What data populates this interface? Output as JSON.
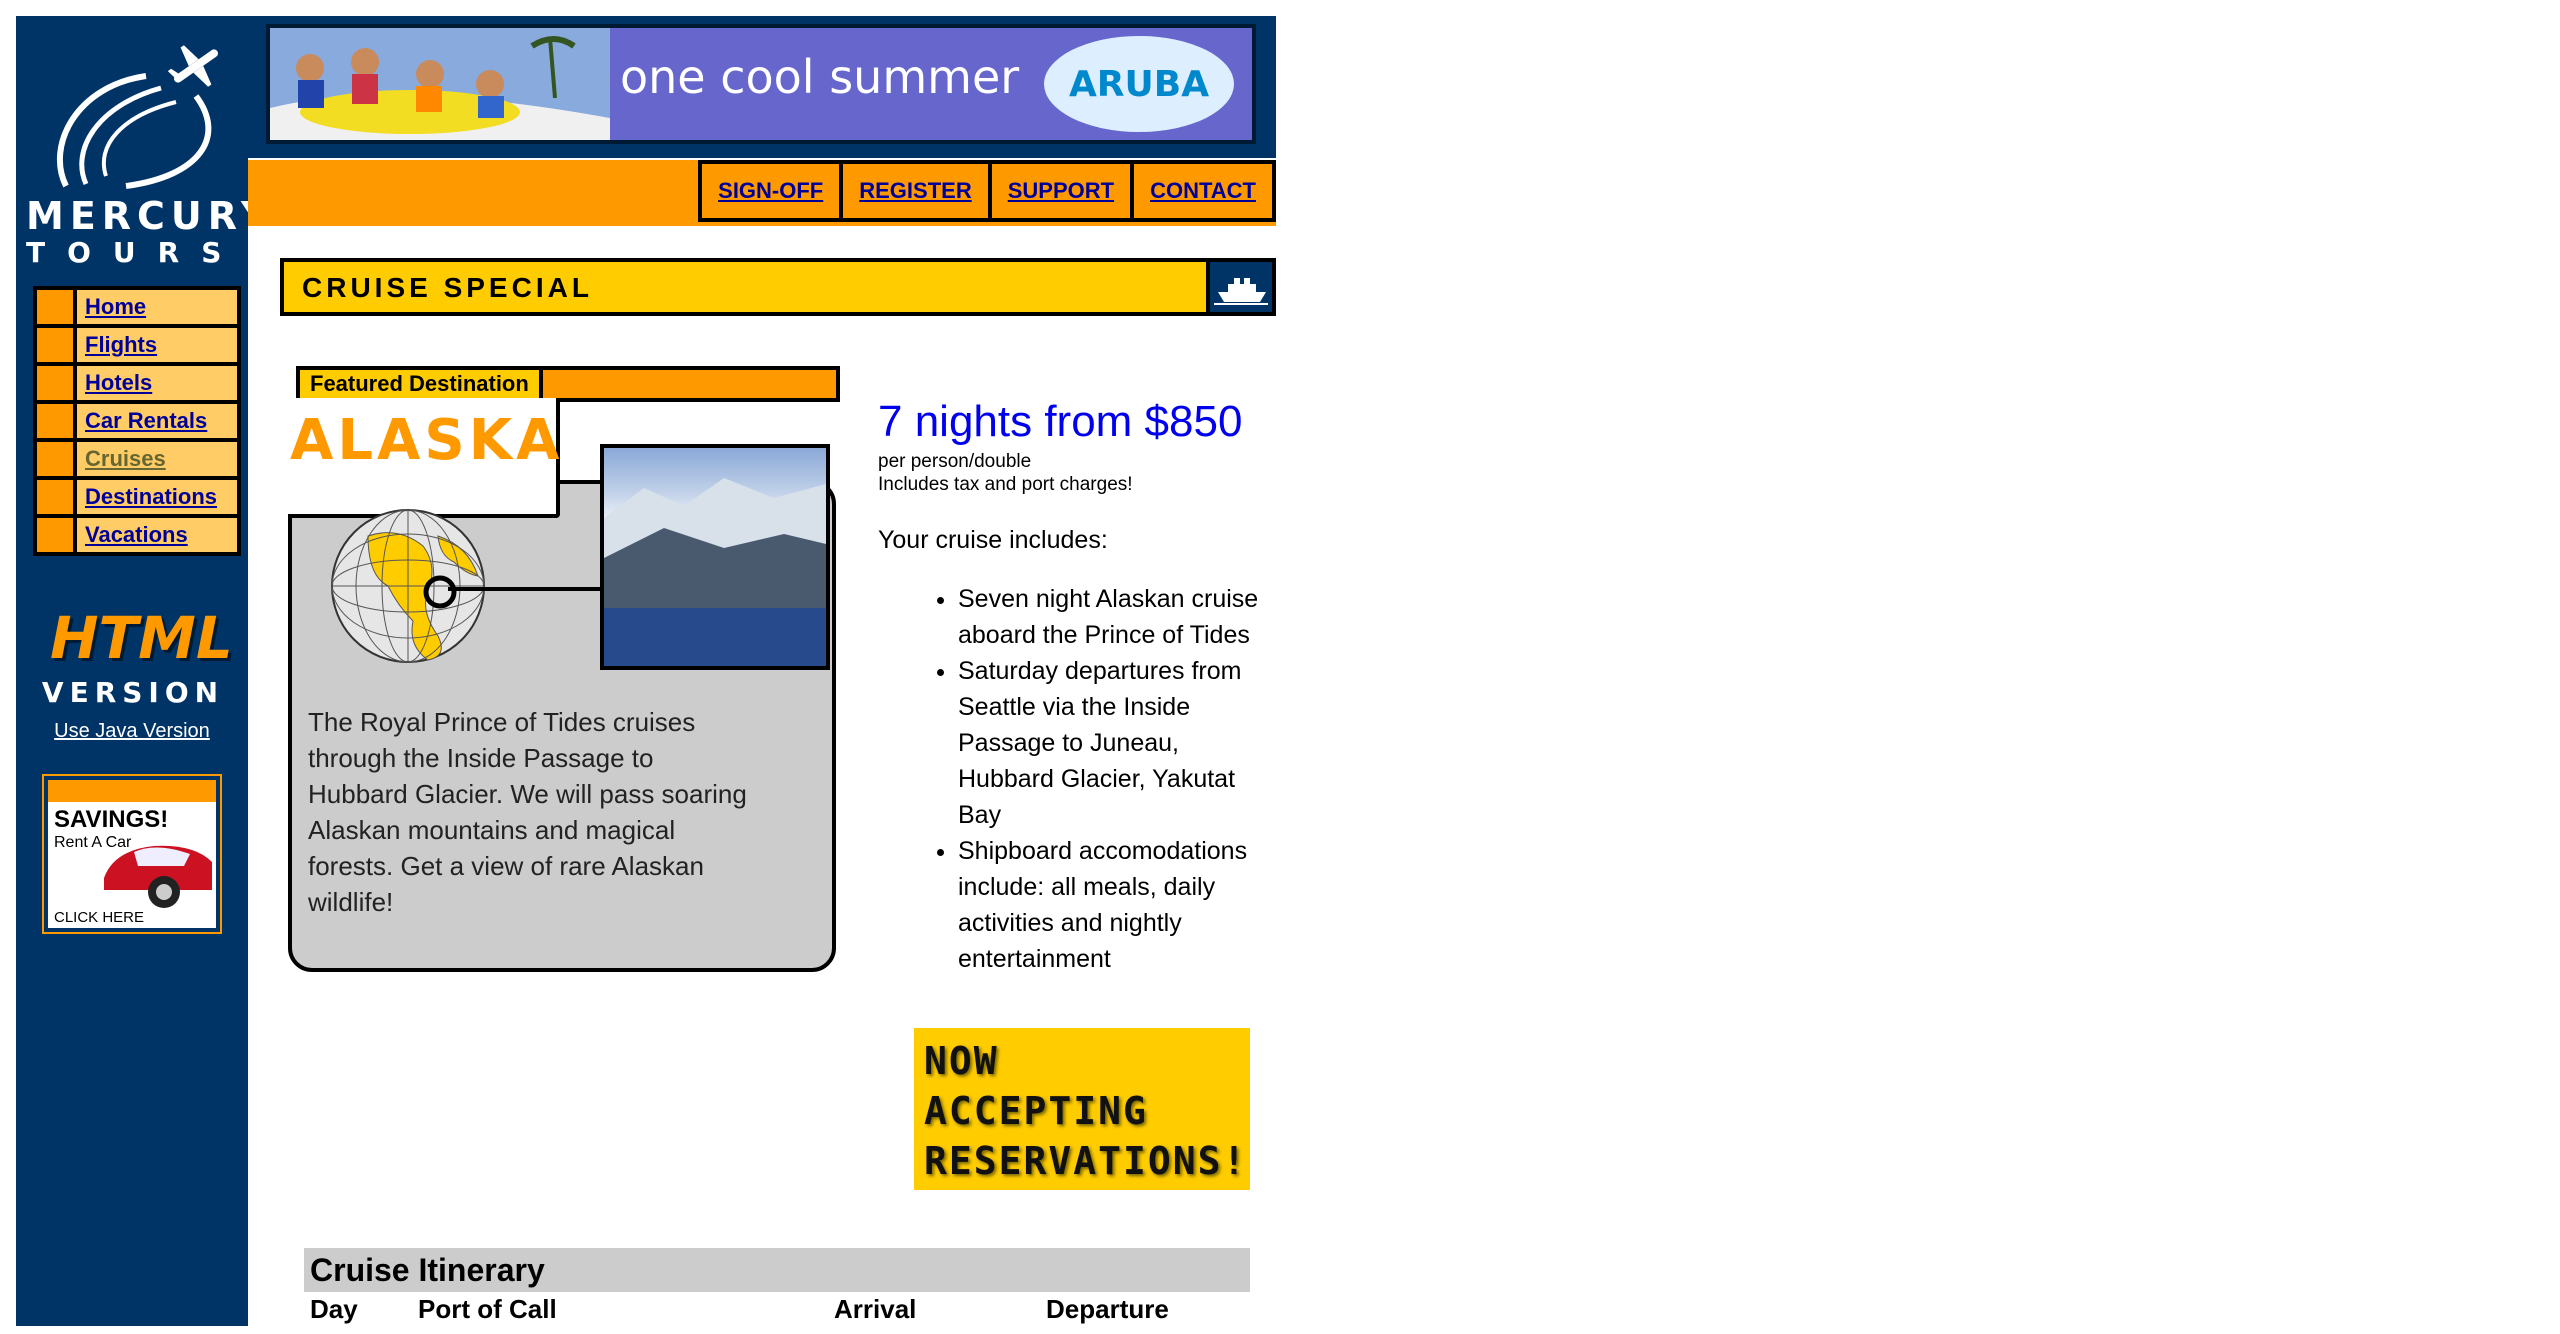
{
  "brand": {
    "name_line1": "MERCURY",
    "name_line2": "TOURS"
  },
  "banner": {
    "text": "one cool summer",
    "logo_text": "ARUBA"
  },
  "top_nav": [
    {
      "label": "SIGN-OFF"
    },
    {
      "label": "REGISTER"
    },
    {
      "label": "SUPPORT"
    },
    {
      "label": "CONTACT"
    }
  ],
  "sidebar": {
    "items": [
      {
        "label": "Home"
      },
      {
        "label": "Flights"
      },
      {
        "label": "Hotels"
      },
      {
        "label": "Car Rentals"
      },
      {
        "label": "Cruises"
      },
      {
        "label": "Destinations"
      },
      {
        "label": "Vacations"
      }
    ],
    "version_badge_line1": "HTML",
    "version_badge_line2": "VERSION",
    "java_link": "Use Java Version",
    "ad": {
      "headline": "SAVINGS!",
      "subline": "Rent A Car",
      "cta": "CLICK HERE"
    }
  },
  "section": {
    "title": "CRUISE SPECIAL"
  },
  "featured": {
    "tab_label": "Featured Destination",
    "destination": "ALASKA",
    "description": "The Royal Prince of Tides cruises through the Inside Passage to Hubbard Glacier. We will pass soaring Alaskan mountains and magical forests. Get a view of rare Alaskan wildlife!"
  },
  "offer": {
    "headline": "7 nights from $850",
    "per_person": "per person/double",
    "tax_note": "Includes tax and port charges!",
    "includes_label": "Your cruise includes:",
    "includes": [
      "Seven night Alaskan cruise aboard the Prince of Tides",
      "Saturday departures from Seattle via the Inside Passage to Juneau, Hubbard Glacier, Yakutat Bay",
      "Shipboard accomodations include: all meals, daily activities and nightly entertainment"
    ]
  },
  "reservations_sign": {
    "line1": "NOW",
    "line2": "ACCEPTING",
    "line3": "RESERVATIONS!"
  },
  "itinerary": {
    "title": "Cruise Itinerary",
    "columns": [
      "Day",
      "Port of Call",
      "Arrival",
      "Departure"
    ]
  },
  "colors": {
    "sidebar_bg": "#003366",
    "accent_orange": "#ff9900",
    "accent_yellow": "#ffcc00",
    "nav_item_bg": "#ffcc66",
    "link": "#000099",
    "visited_link": "#666633",
    "price_blue": "#0000ee"
  }
}
